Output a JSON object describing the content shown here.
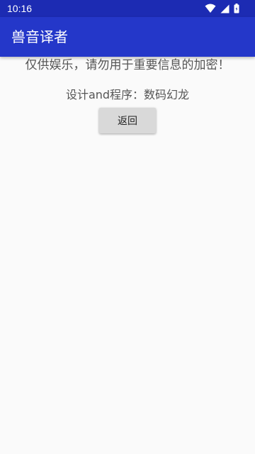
{
  "status_bar": {
    "time": "10:16",
    "icons": [
      "wifi-icon",
      "signal-icon",
      "battery-icon"
    ],
    "color": "#1c2bb3"
  },
  "app_bar": {
    "title": "兽音译者",
    "color": "#2437c9"
  },
  "main": {
    "notice": "仅供娱乐，请勿用于重要信息的加密！",
    "credits": "设计and程序：数码幻龙",
    "back_label": "返回"
  }
}
